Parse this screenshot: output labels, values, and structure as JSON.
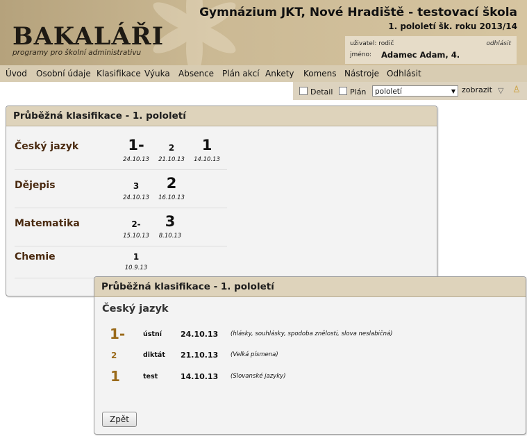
{
  "header": {
    "logo": "BAKALÁŘI",
    "tagline": "programy pro školní administrativu",
    "school": "Gymnázium JKT, Nové Hradiště - testovací škola",
    "term": "1. pololetí šk. roku 2013/14",
    "user_label": "uživatel:",
    "user_value": "rodič",
    "logout": "odhlásit",
    "name_label": "jméno:",
    "name_value": "Adamec Adam, 4."
  },
  "menu": [
    "Úvod",
    "Osobní údaje",
    "Klasifikace",
    "Výuka",
    "Absence",
    "Plán akcí",
    "Ankety",
    "Komens",
    "Nástroje",
    "Odhlásit"
  ],
  "toolbar": {
    "detail": "Detail",
    "plan": "Plán",
    "period": "pololetí",
    "show": "zobrazit"
  },
  "summary": {
    "title": "Průběžná klasifikace - 1. pololetí",
    "subjects": [
      {
        "name": "Český jazyk",
        "grades": [
          {
            "g": "1-",
            "d": "24.10.13"
          },
          {
            "g": "2",
            "d": "21.10.13"
          },
          {
            "g": "1",
            "d": "14.10.13"
          }
        ]
      },
      {
        "name": "Dějepis",
        "grades": [
          {
            "g": "3",
            "d": "24.10.13"
          },
          {
            "g": "2",
            "d": "16.10.13"
          }
        ]
      },
      {
        "name": "Matematika",
        "grades": [
          {
            "g": "2-",
            "d": "15.10.13"
          },
          {
            "g": "3",
            "d": "8.10.13"
          }
        ]
      },
      {
        "name": "Chemie",
        "grades": [
          {
            "g": "1",
            "d": "10.9.13"
          }
        ]
      }
    ]
  },
  "detail": {
    "title": "Průběžná klasifikace - 1. pololetí",
    "subject": "Český jazyk",
    "rows": [
      {
        "grade": "1-",
        "type": "ústní",
        "date": "24.10.13",
        "note": "(hlásky, souhlásky, spodoba znělosti, slova neslabičná)"
      },
      {
        "grade": "2",
        "type": "diktát",
        "date": "21.10.13",
        "note": "(Velká písmena)"
      },
      {
        "grade": "1",
        "type": "test",
        "date": "14.10.13",
        "note": "(Slovanské jazyky)"
      }
    ],
    "back": "Zpět"
  },
  "colors": {
    "header": "#cbb994",
    "menu": "#d8ccb2",
    "subject": "#4a2a10",
    "grade_accent": "#9a6a1a"
  }
}
